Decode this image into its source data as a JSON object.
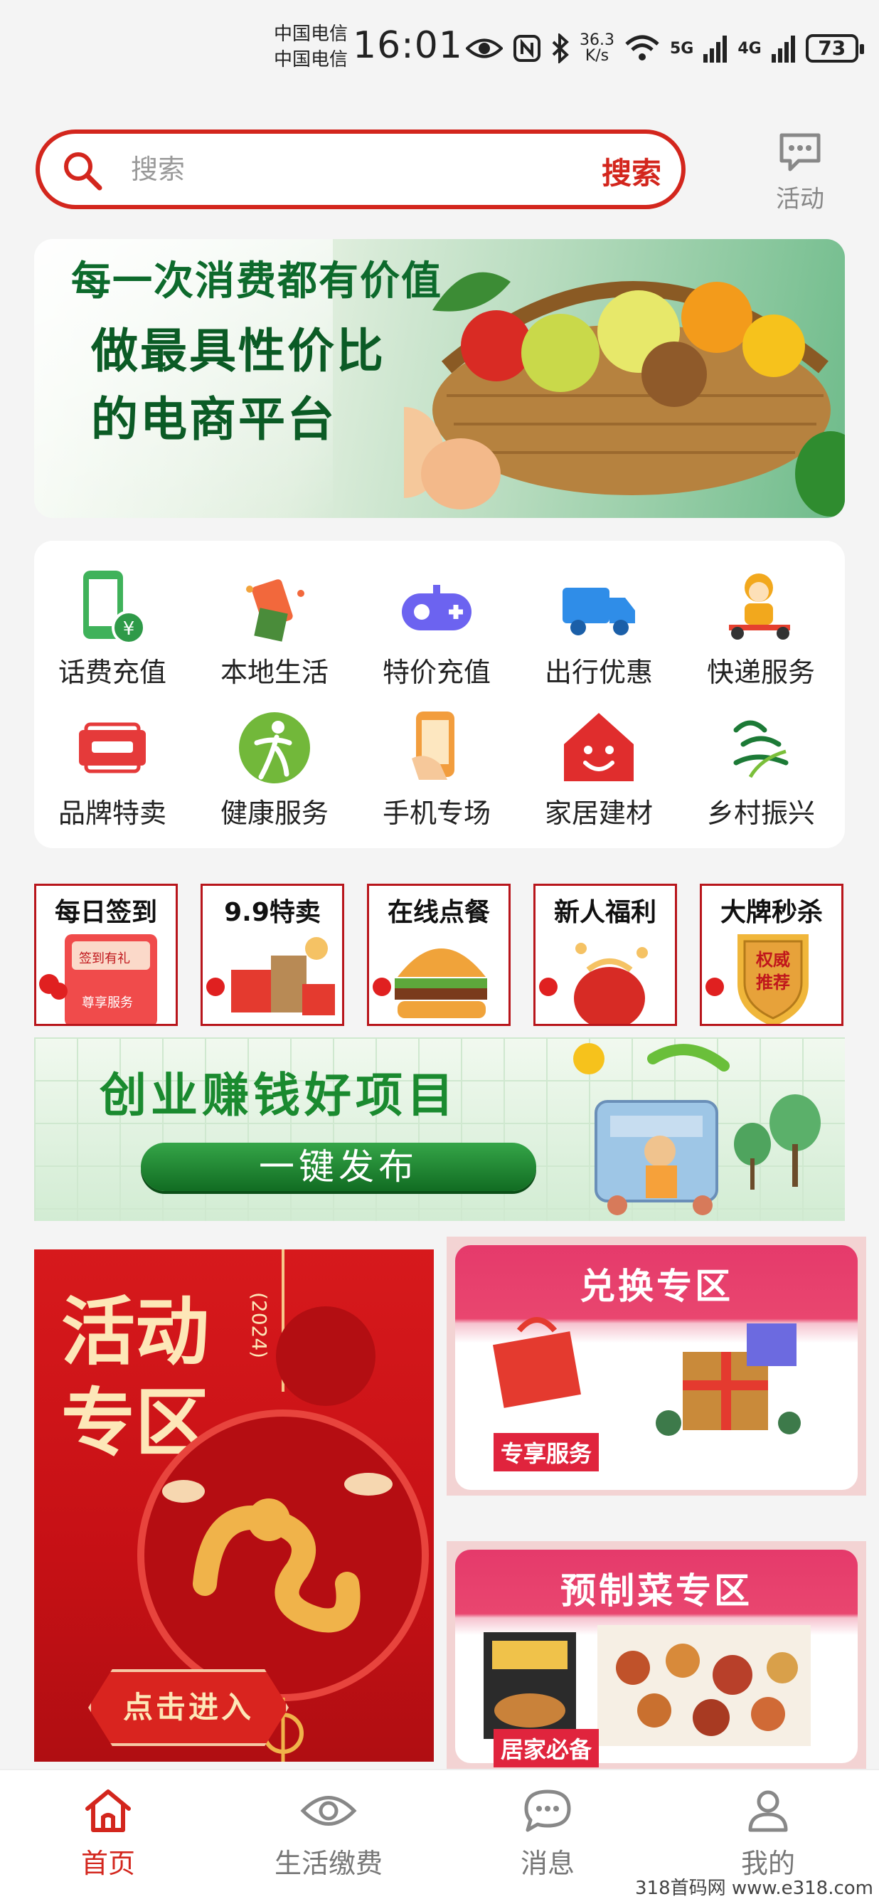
{
  "status_bar": {
    "carrier_1": "中国电信",
    "carrier_2": "中国电信",
    "time": "16:01",
    "speed_value": "36.3",
    "speed_unit": "K/s",
    "net_1": "5G",
    "net_2": "4G",
    "battery": "73"
  },
  "search": {
    "placeholder": "搜索",
    "button_label": "搜索"
  },
  "activity": {
    "label": "活动"
  },
  "banner_top": {
    "headline": "每一次消费都有价值",
    "slogan_line1": "做最具性价比",
    "slogan_line2": "的电商平台"
  },
  "categories": [
    {
      "label": "话费充值",
      "icon": "phone-yuan-icon"
    },
    {
      "label": "本地生活",
      "icon": "gift-icon"
    },
    {
      "label": "特价充值",
      "icon": "gamepad-icon"
    },
    {
      "label": "出行优惠",
      "icon": "truck-icon"
    },
    {
      "label": "快递服务",
      "icon": "courier-icon"
    },
    {
      "label": "品牌特卖",
      "icon": "brand-tag-icon"
    },
    {
      "label": "健康服务",
      "icon": "health-icon"
    },
    {
      "label": "手机专场",
      "icon": "phone-hand-icon"
    },
    {
      "label": "家居建材",
      "icon": "house-icon"
    },
    {
      "label": "乡村振兴",
      "icon": "rural-icon"
    }
  ],
  "promo_tiles": [
    {
      "label": "每日签到",
      "badge_1": "签到有礼",
      "badge_2": "尊享服务"
    },
    {
      "label": "9.9特卖"
    },
    {
      "label": "在线点餐"
    },
    {
      "label": "新人福利"
    },
    {
      "label": "大牌秒杀",
      "badge_1": "权威",
      "badge_2": "推荐"
    }
  ],
  "banner_mid": {
    "title": "创业赚钱好项目",
    "button": "一键发布"
  },
  "zones": {
    "activity_title_line1": "活动",
    "activity_title_line2": "专区",
    "activity_year": "(2024)",
    "activity_enter": "点击进入",
    "exchange_title": "兑换专区",
    "exchange_ribbon": "专享服务",
    "prepared_title": "预制菜专区",
    "prepared_ribbon": "居家必备"
  },
  "tabbar": [
    {
      "label": "首页",
      "active": true
    },
    {
      "label": "生活缴费",
      "active": false
    },
    {
      "label": "消息",
      "active": false
    },
    {
      "label": "我的",
      "active": false
    }
  ],
  "watermark": "318首码网 www.e318.com",
  "colors": {
    "brand_red": "#d3261d",
    "green": "#0d6a2c"
  }
}
